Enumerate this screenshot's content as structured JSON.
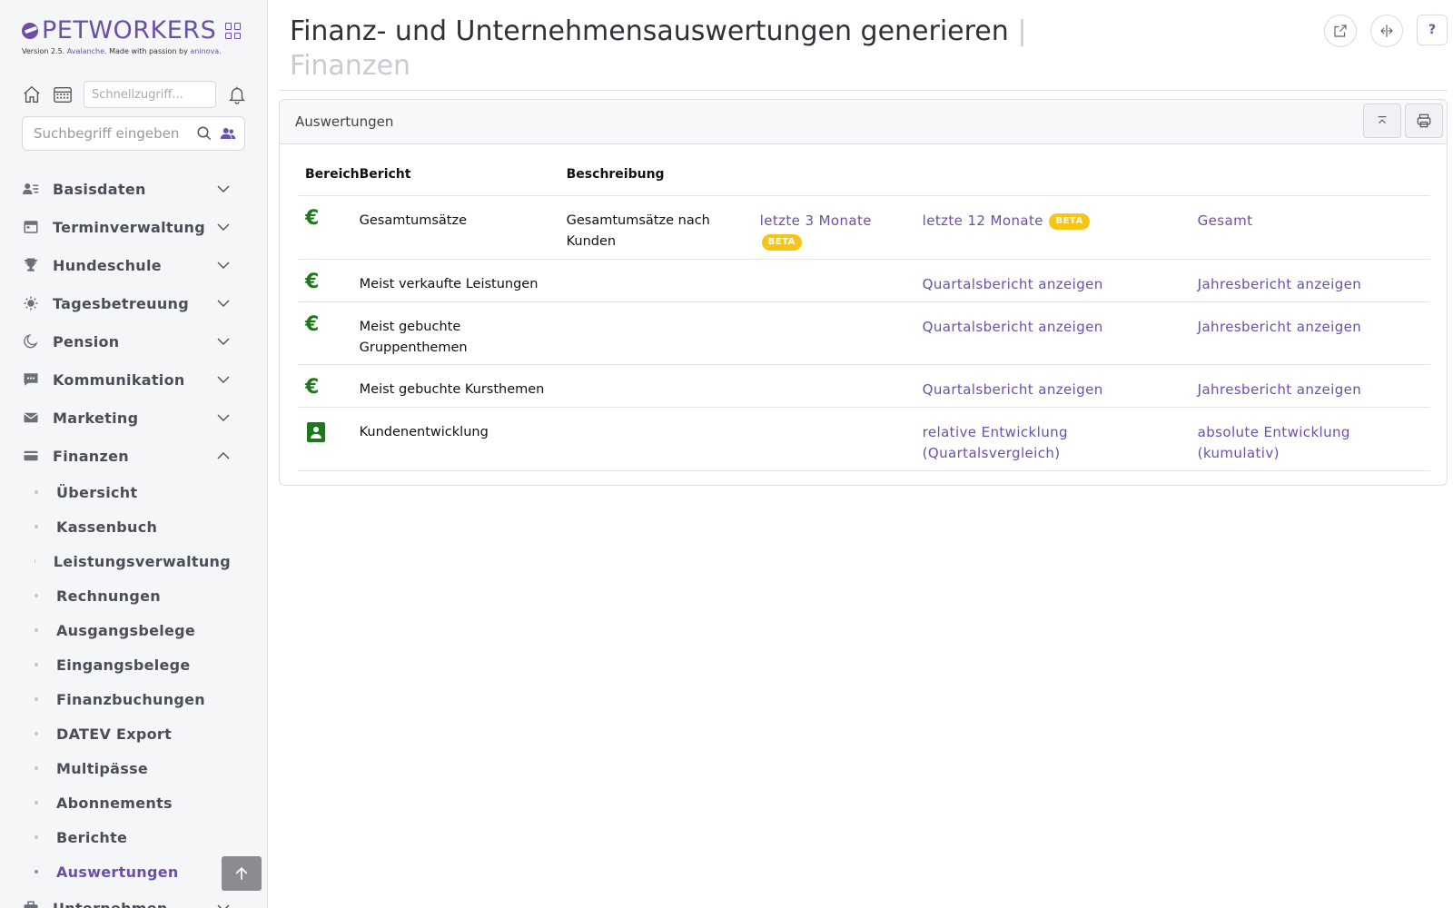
{
  "brand": {
    "name": "PETWORKERS",
    "version_prefix": "Version 2.5.",
    "version_name": "Avalanche.",
    "made_with": "Made with passion by",
    "company": "aninova."
  },
  "quick": {
    "placeholder": "Schnellzugriff..."
  },
  "search": {
    "placeholder": "Suchbegriff eingeben"
  },
  "nav": [
    {
      "label": "Basisdaten",
      "icon": "person-list-icon"
    },
    {
      "label": "Terminverwaltung",
      "icon": "calendar-icon"
    },
    {
      "label": "Hundeschule",
      "icon": "trophy-icon"
    },
    {
      "label": "Tagesbetreuung",
      "icon": "sun-icon"
    },
    {
      "label": "Pension",
      "icon": "moon-icon"
    },
    {
      "label": "Kommunikation",
      "icon": "chat-icon"
    },
    {
      "label": "Marketing",
      "icon": "mail-icon"
    },
    {
      "label": "Finanzen",
      "icon": "credit-card-icon"
    },
    {
      "label": "Unternehmen",
      "icon": "briefcase-icon"
    }
  ],
  "finanzen_sub": [
    "Übersicht",
    "Kassenbuch",
    "Leistungsverwaltung",
    "Rechnungen",
    "Ausgangsbelege",
    "Eingangsbelege",
    "Finanzbuchungen",
    "DATEV Export",
    "Multipässe",
    "Abonnements",
    "Berichte",
    "Auswertungen"
  ],
  "page": {
    "title": "Finanz- und Unternehmensauswertungen generieren",
    "separator": "|",
    "subtitle": "Finanzen"
  },
  "card": {
    "title": "Auswertungen"
  },
  "table": {
    "headers": [
      "Bereich",
      "Bericht",
      "Beschreibung"
    ],
    "rows": [
      {
        "icon": "euro-icon",
        "bericht": "Gesamtumsätze",
        "beschreibung": "Gesamtumsätze nach Kunden",
        "link1": "letzte 3 Monate",
        "link1_badge": "BETA",
        "link2": "letzte 12 Monate",
        "link2_badge": "BETA",
        "link3": "Gesamt"
      },
      {
        "icon": "euro-icon",
        "bericht": "Meist verkaufte Leistungen",
        "beschreibung": "",
        "link1": "",
        "link2": "Quartalsbericht anzeigen",
        "link3": "Jahresbericht anzeigen"
      },
      {
        "icon": "euro-icon",
        "bericht": "Meist gebuchte Gruppenthemen",
        "beschreibung": "",
        "link1": "",
        "link2": "Quartalsbericht anzeigen",
        "link3": "Jahresbericht anzeigen"
      },
      {
        "icon": "euro-icon",
        "bericht": "Meist gebuchte Kursthemen",
        "beschreibung": "",
        "link1": "",
        "link2": "Quartalsbericht anzeigen",
        "link3": "Jahresbericht anzeigen"
      },
      {
        "icon": "contact-icon",
        "bericht": "Kundenentwicklung",
        "beschreibung": "",
        "link1": "",
        "link2": "relative Entwicklung (Quartalsvergleich)",
        "link3": "absolute Entwicklung (kumulativ)"
      }
    ]
  },
  "colors": {
    "accent": "#6c4fa8",
    "euro": "#1a7a1a",
    "beta": "#f5c518"
  },
  "euro_symbol": "€",
  "help_label": "?"
}
